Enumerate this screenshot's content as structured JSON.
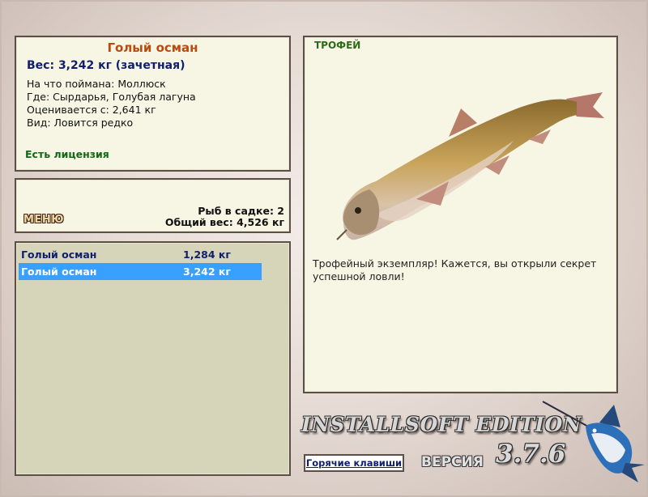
{
  "info": {
    "name": "Голый осман",
    "weight": "Вес: 3,242 кг (зачетная)",
    "caught_on": "На что поймана: Моллюск",
    "location": "Где: Сырдарья, Голубая лагуна",
    "scored_from": "Оценивается с: 2,641 кг",
    "rarity": "Вид: Ловится редко",
    "license": "Есть лицензия"
  },
  "menu": {
    "label": "МЕНЮ",
    "cage_count": "Рыб в садке: 2",
    "cage_total": "Общий вес: 4,526 кг"
  },
  "catch_list": [
    {
      "name": "Голый осман",
      "weight": "1,284 кг"
    },
    {
      "name": "Голый осман",
      "weight": "3,242 кг"
    }
  ],
  "trophy": {
    "title": "ТРОФЕЙ",
    "message": "Трофейный экземпляр! Кажется, вы открыли секрет успешной ловли!"
  },
  "footer": {
    "hotkeys_label": "Горячие клавиши",
    "edition": "INSTALLSOFT EDITION",
    "version_label": "ВЕРСИЯ",
    "version": "3.7.6"
  },
  "colors": {
    "panel_bg": "#f7f6e4",
    "list_bg": "#d7d5b9",
    "selected_row": "#3aa0ff",
    "name_color": "#b84a12",
    "license_color": "#0e6a16"
  }
}
